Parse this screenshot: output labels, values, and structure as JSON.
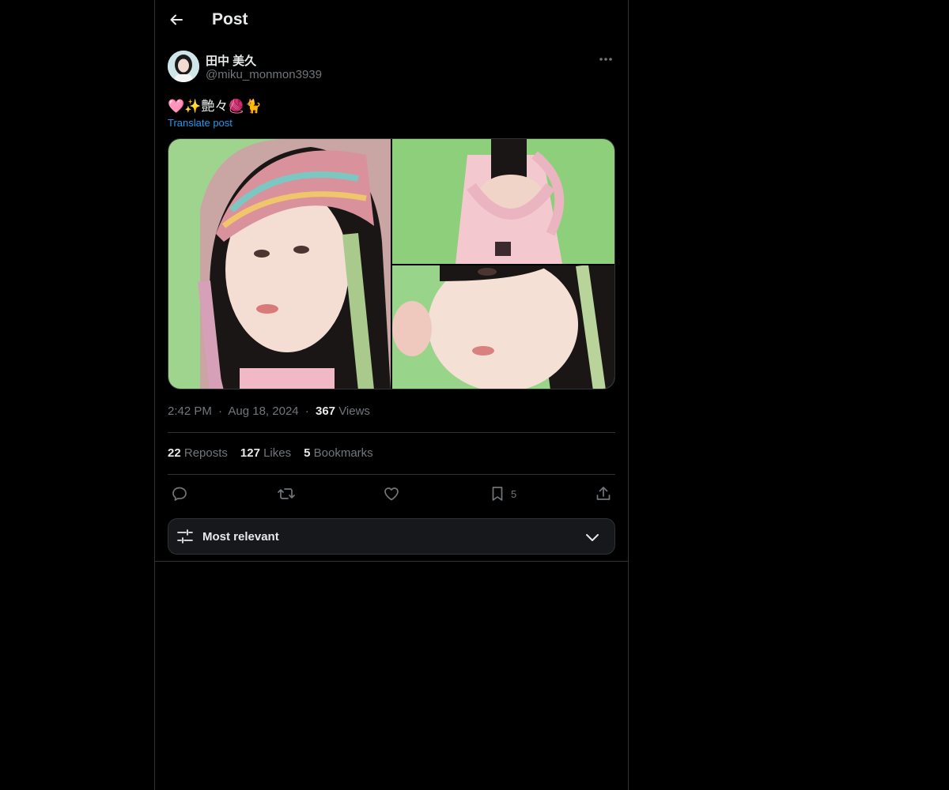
{
  "header": {
    "title": "Post",
    "back_icon": "arrow-left-icon"
  },
  "author": {
    "display_name": "田中 美久",
    "handle": "@miku_monmon3939"
  },
  "post": {
    "text": "🩷✨艶々🧶🐈",
    "translate_label": "Translate post",
    "media_count": 3
  },
  "meta": {
    "time": "2:42 PM",
    "separator": "·",
    "date": "Aug 18, 2024",
    "views_count": "367",
    "views_label": "Views"
  },
  "stats": {
    "reposts_count": "22",
    "reposts_label": "Reposts",
    "likes_count": "127",
    "likes_label": "Likes",
    "bookmarks_count": "5",
    "bookmarks_label": "Bookmarks"
  },
  "actions": {
    "reply_icon": "reply-icon",
    "repost_icon": "repost-icon",
    "like_icon": "heart-icon",
    "bookmark_icon": "bookmark-icon",
    "bookmark_count": "5",
    "share_icon": "share-icon"
  },
  "sort": {
    "label": "Most relevant",
    "icon": "sliders-icon",
    "chevron": "chevron-down-icon"
  },
  "colors": {
    "background": "#000000",
    "text": "#e7e9ea",
    "muted": "#71767b",
    "border": "#2f3336",
    "link": "#1d9bf0",
    "sort_bg": "#16181c"
  }
}
